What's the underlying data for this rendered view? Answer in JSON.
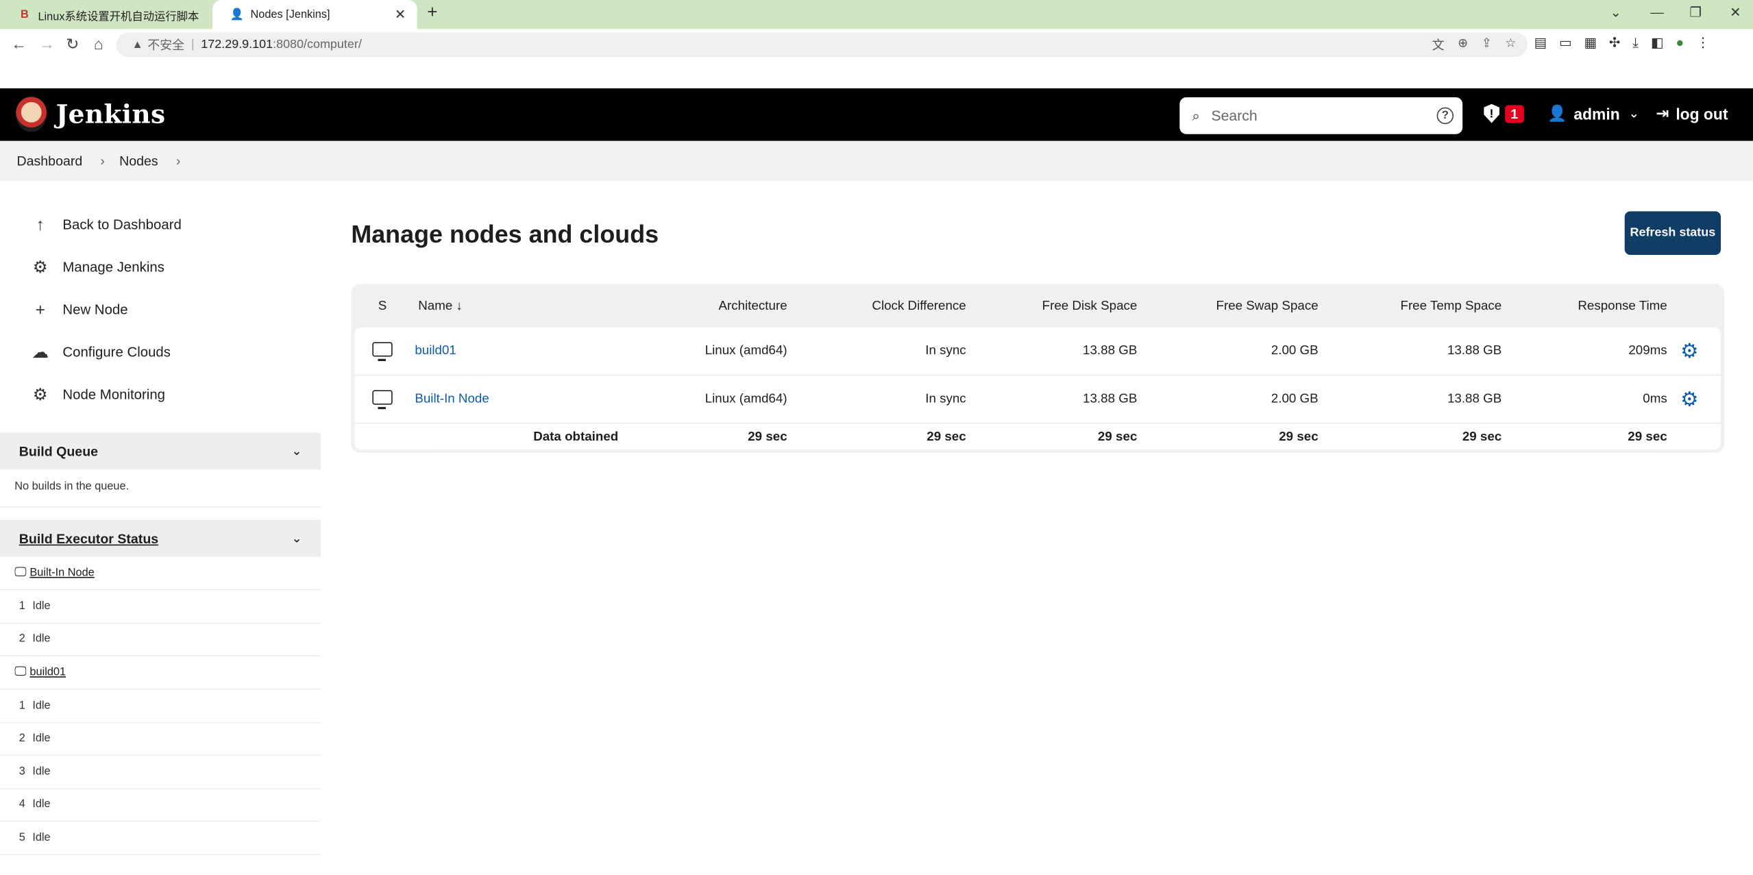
{
  "browser": {
    "tabs": [
      {
        "title": "Linux系统设置开机自动运行脚本",
        "favicon": "B",
        "active": false
      },
      {
        "title": "Nodes [Jenkins]",
        "favicon": "jenkins",
        "active": true
      }
    ],
    "address": {
      "security_label": "不安全",
      "host": "172.29.9.101",
      "path": ":8080/computer/"
    }
  },
  "header": {
    "brand": "Jenkins",
    "search_placeholder": "Search",
    "security_count": "1",
    "user": "admin",
    "logout": "log out"
  },
  "breadcrumb": [
    "Dashboard",
    "Nodes"
  ],
  "sidebar": {
    "tasks": [
      {
        "label": "Back to Dashboard",
        "icon": "arrow-up-icon"
      },
      {
        "label": "Manage Jenkins",
        "icon": "gear-icon"
      },
      {
        "label": "New Node",
        "icon": "plus-icon"
      },
      {
        "label": "Configure Clouds",
        "icon": "cloud-icon"
      },
      {
        "label": "Node Monitoring",
        "icon": "gear-icon"
      }
    ],
    "build_queue": {
      "title": "Build Queue",
      "empty_text": "No builds in the queue."
    },
    "executor_status": {
      "title": "Build Executor Status",
      "nodes": [
        {
          "name": "Built-In Node",
          "executors": [
            {
              "n": "1",
              "status": "Idle"
            },
            {
              "n": "2",
              "status": "Idle"
            }
          ]
        },
        {
          "name": "build01",
          "executors": [
            {
              "n": "1",
              "status": "Idle"
            },
            {
              "n": "2",
              "status": "Idle"
            },
            {
              "n": "3",
              "status": "Idle"
            },
            {
              "n": "4",
              "status": "Idle"
            },
            {
              "n": "5",
              "status": "Idle"
            }
          ]
        }
      ]
    }
  },
  "main": {
    "title": "Manage nodes and clouds",
    "refresh_label": "Refresh status",
    "columns": [
      "S",
      "Name ↓",
      "Architecture",
      "Clock Difference",
      "Free Disk Space",
      "Free Swap Space",
      "Free Temp Space",
      "Response Time"
    ],
    "rows": [
      {
        "name": "build01",
        "arch": "Linux (amd64)",
        "clock": "In sync",
        "disk": "13.88 GB",
        "swap": "2.00 GB",
        "temp": "13.88 GB",
        "resp": "209ms"
      },
      {
        "name": "Built-In Node",
        "arch": "Linux (amd64)",
        "clock": "In sync",
        "disk": "13.88 GB",
        "swap": "2.00 GB",
        "temp": "13.88 GB",
        "resp": "0ms"
      }
    ],
    "footer": {
      "label": "Data obtained",
      "arch": "29 sec",
      "clock": "29 sec",
      "disk": "29 sec",
      "swap": "29 sec",
      "temp": "29 sec",
      "resp": "29 sec"
    }
  },
  "colors": {
    "header_bg": "#000000",
    "link": "#0b5cad",
    "button": "#0f3d66",
    "badge": "#e6001f",
    "tabbar": "#cfe6c3"
  }
}
